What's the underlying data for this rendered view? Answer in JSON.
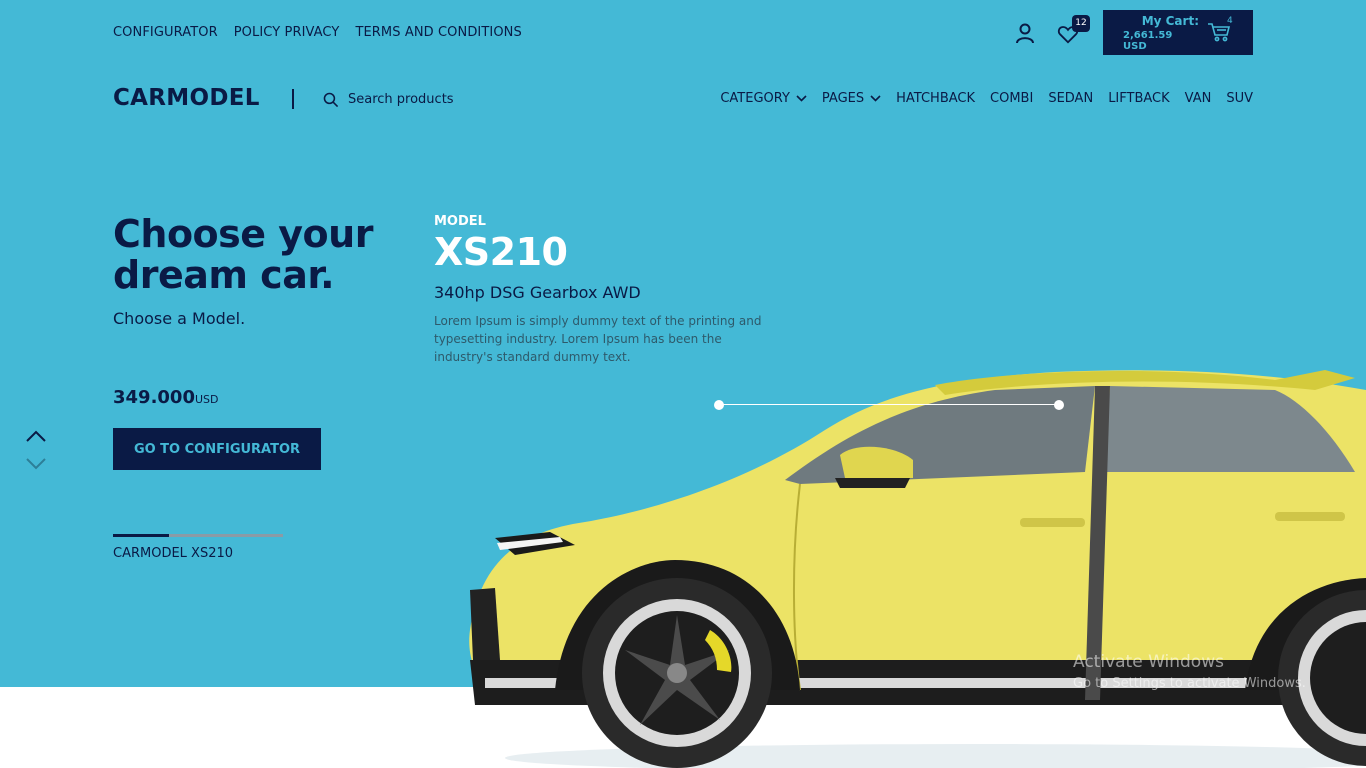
{
  "colors": {
    "accent": "#44b9d6",
    "navy": "#0a1a45",
    "car": "#eee266"
  },
  "topbar": {
    "links": [
      "CONFIGURATOR",
      "POLICY PRIVACY",
      "TERMS AND CONDITIONS"
    ],
    "wishlist_count": "12",
    "cart": {
      "label": "My Cart:",
      "total": "2,661.59 USD",
      "count": "4"
    }
  },
  "header": {
    "logo": "CARMODEL",
    "search": {
      "placeholder": "Search products"
    },
    "nav": [
      "CATEGORY",
      "PAGES",
      "HATCHBACK",
      "COMBI",
      "SEDAN",
      "LIFTBACK",
      "VAN",
      "SUV"
    ]
  },
  "hero": {
    "headline": "Choose your dream car.",
    "subhead": "Choose a Model.",
    "price_value": "349.000",
    "price_currency": "USD",
    "cta": "GO TO CONFIGURATOR",
    "slide_progress": 0.33,
    "slide_name": "CARMODEL XS210"
  },
  "model": {
    "label": "MODEL",
    "name": "XS210",
    "spec": "340hp DSG Gearbox AWD",
    "description": "Lorem Ipsum is simply dummy text of the printing and typesetting industry. Lorem Ipsum has been the industry's standard dummy text."
  },
  "watermark": {
    "line1": "Activate Windows",
    "line2": "Go to Settings to activate Windows."
  }
}
